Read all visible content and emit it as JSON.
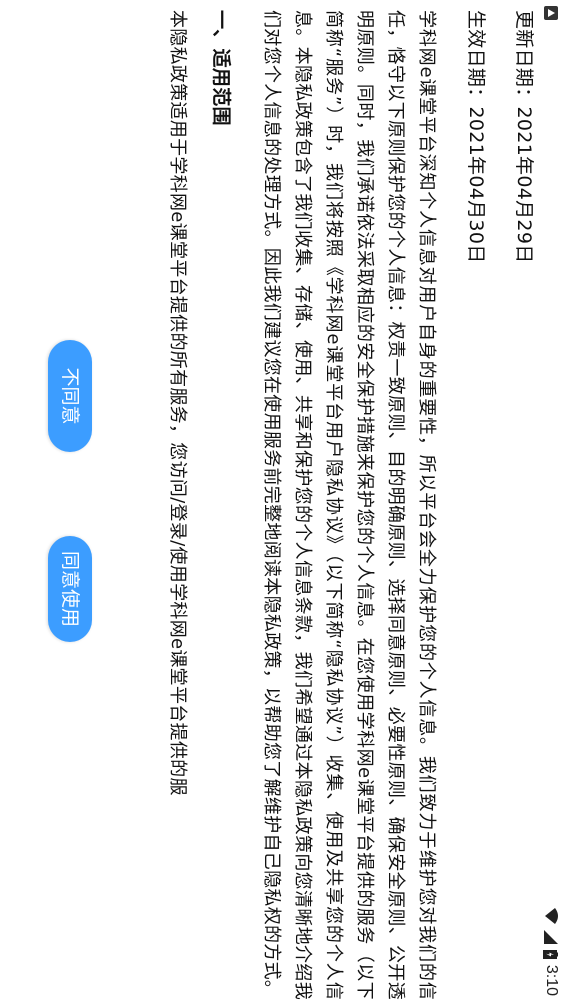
{
  "status_bar": {
    "time": "3:10",
    "icons": [
      "notification-icon",
      "wifi-icon",
      "signal-icon",
      "battery-icon"
    ]
  },
  "policy": {
    "updated_label": "更新日期：2021年04月29日",
    "effective_label": "生效日期：2021年04月30日",
    "intro": "学科网e课堂平台深知个人信息对用户自身的重要性，所以平台会全力保护您的个人信息。我们致力于维护您对我们的信任，恪守以下原则保护您的个人信息：权责一致原则、目的明确原则、选择同意原则、必要性原则、确保安全原则、公开透明原则。同时，我们承诺依法采取相应的安全保护措施来保护您的个人信息。在您使用学科网e课堂平台提供的服务（以下简称“服务”）时，我们将按照《学科网e课堂平台用户隐私协议》（以下简称“隐私协议”）收集、使用及共享您的个人信息。本隐私政策包含了我们收集、存储、使用、共享和保护您的个人信息条款，我们希望通过本隐私政策向您清晰地介绍我们对您个人信息的处理方式。因此我们建议您在使用服务前完整地阅读本隐私政策，以帮助您了解维护自己隐私权的方式。",
    "section1_title": "一、适用范围",
    "section1_body": "本隐私政策适用于学科网e课堂平台提供的所有服务，您访问/登录/使用学科网e课堂平台提供的服"
  },
  "buttons": {
    "disagree": "不同意",
    "agree": "同意使用"
  },
  "colors": {
    "button_bg": "#3c9dff",
    "button_text": "#ffffff",
    "text": "#111111"
  }
}
